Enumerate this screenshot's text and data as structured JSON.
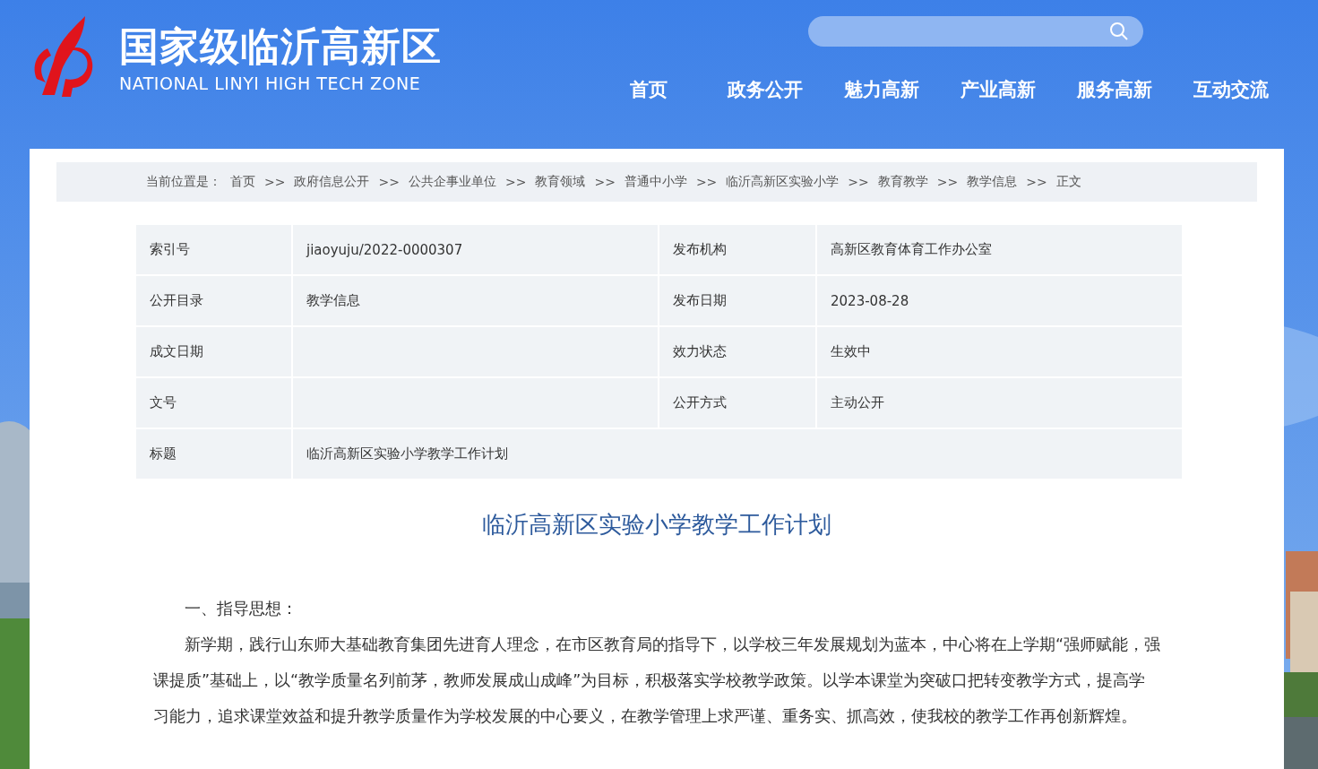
{
  "header": {
    "title": "国家级临沂高新区",
    "subtitle": "NATIONAL LINYI HIGH TECH ZONE",
    "nav": [
      "首页",
      "政务公开",
      "魅力高新",
      "产业高新",
      "服务高新",
      "互动交流"
    ]
  },
  "breadcrumb": {
    "label": "当前位置是：",
    "items": [
      {
        "text": "首页"
      },
      {
        "separator": ">>",
        "text": "政府信息公开"
      },
      {
        "separator": ">>",
        "text": "公共企事业单位"
      },
      {
        "separator": ">>",
        "text": "教育领域"
      },
      {
        "separator": ">>",
        "text": "普通中小学"
      },
      {
        "separator": ">>",
        "text": "临沂高新区实验小学"
      },
      {
        "separator": ">>",
        "text": "教育教学"
      },
      {
        "separator": ">>",
        "text": "教学信息"
      },
      {
        "separator": ">>",
        "text": "正文"
      }
    ]
  },
  "info_table": {
    "rows": [
      [
        {
          "label": "索引号",
          "value": "jiaoyuju/2022-0000307"
        },
        {
          "label": "发布机构",
          "value": "高新区教育体育工作办公室"
        }
      ],
      [
        {
          "label": "公开目录",
          "value": "教学信息"
        },
        {
          "label": "发布日期",
          "value": "2023-08-28"
        }
      ],
      [
        {
          "label": "成文日期"
        },
        {
          "label": "效力状态",
          "value": "生效中"
        }
      ],
      [
        {
          "label": "文号"
        },
        {
          "label": "公开方式",
          "value": "主动公开"
        }
      ],
      [
        {
          "label": "标题",
          "value": "临沂高新区实验小学教学工作计划"
        }
      ]
    ]
  },
  "article": {
    "title": "临沂高新区实验小学教学工作计划",
    "paragraphs": [
      "一、指导思想：",
      "新学期，践行山东师大基础教育集团先进育人理念，在市区教育局的指导下，以学校三年发展规划为蓝本，中心将在上学期“强师赋能，强课提质”基础上，以“教学质量名列前茅，教师发展成山成峰”为目标，积极落实学校教学政策。以学本课堂为突破口把转变教学方式，提高学习能力，追求课堂效益和提升教学质量作为学校发展的中心要义，在教学管理上求严谨、重务实、抓高效，使我校的教学工作再创新辉煌。"
    ]
  }
}
